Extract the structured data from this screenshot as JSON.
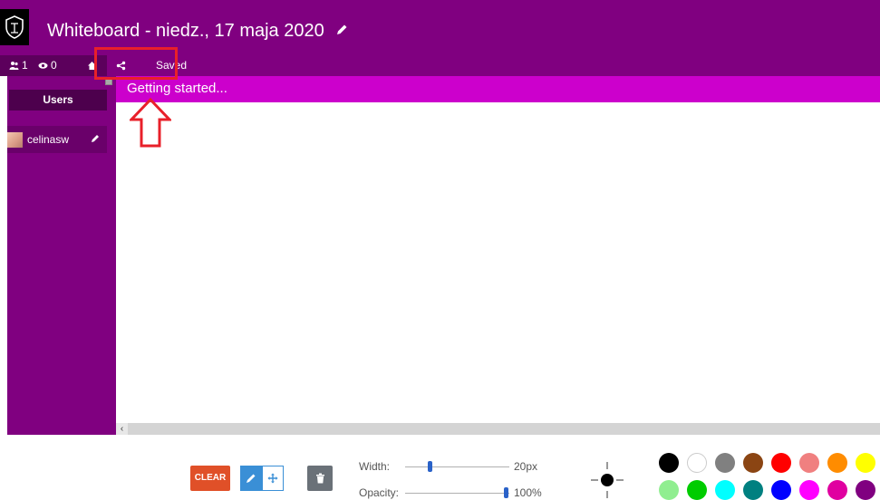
{
  "window": {
    "title": "Whiteboard - niedz., 17 maja 2020"
  },
  "toolbar": {
    "users_count": "1",
    "viewers_count": "0",
    "save_status": "Saved"
  },
  "sidebar": {
    "header": "Users",
    "users": [
      {
        "name": "celinasw"
      }
    ]
  },
  "board": {
    "status_text": "Getting started..."
  },
  "controls": {
    "clear_label": "CLEAR",
    "width_label": "Width:",
    "width_value": "20px",
    "opacity_label": "Opacity:",
    "opacity_value": "100%",
    "width_fraction": 0.24,
    "opacity_fraction": 1.0
  },
  "colors": {
    "brand": "#800080",
    "status_bar": "#cc00cc",
    "annotation": "#e8202a",
    "palette_row1": [
      "#000000",
      "#ffffff",
      "#808080",
      "#8b4513",
      "#ff0000",
      "#f08080",
      "#ff8c00",
      "#ffff00"
    ],
    "palette_row2": [
      "#90ee90",
      "#00cc00",
      "#00ffff",
      "#008080",
      "#0000ff",
      "#ff00ff",
      "#e000a0",
      "#800080"
    ]
  },
  "icons": [
    "shield-logo-icon",
    "pencil-icon",
    "users-icon",
    "eye-icon",
    "home-icon",
    "share-icon",
    "brush-icon",
    "move-icon",
    "trash-icon",
    "crosshair-icon"
  ]
}
